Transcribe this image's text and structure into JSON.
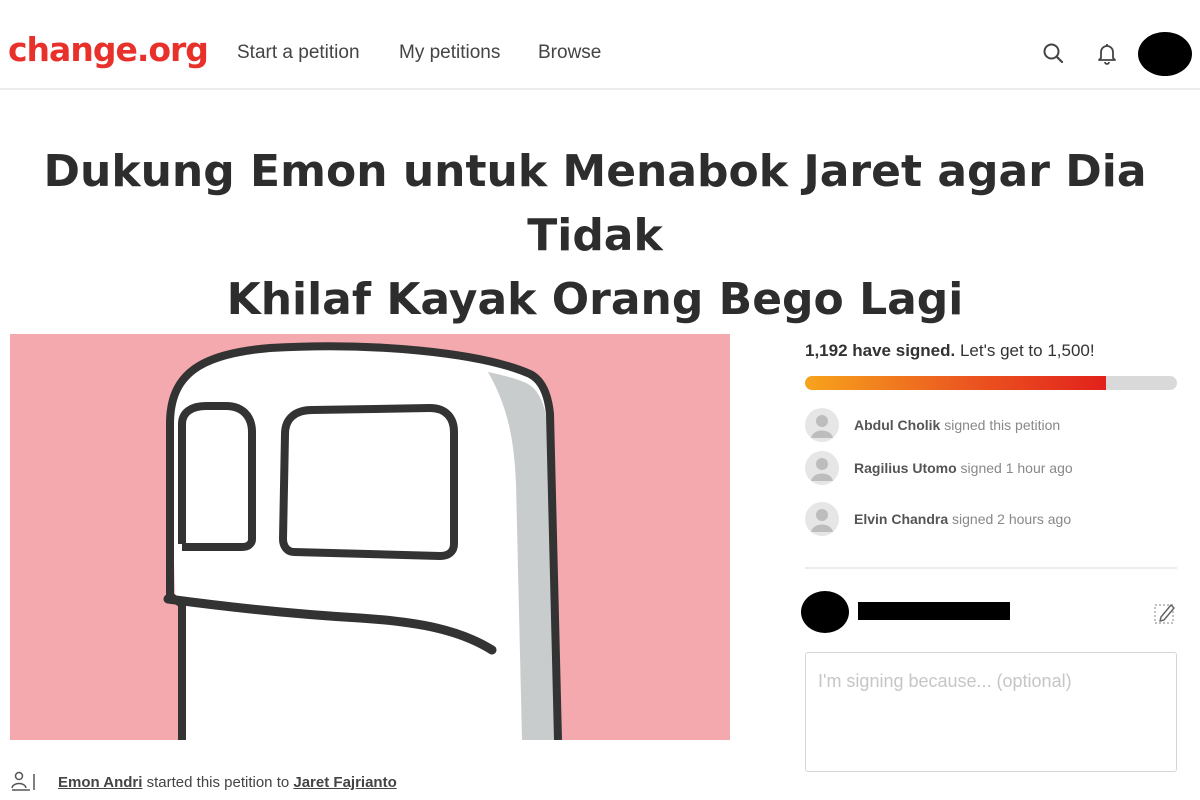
{
  "header": {
    "logo": "change.org",
    "nav": [
      "Start a petition",
      "My petitions",
      "Browse"
    ]
  },
  "petition": {
    "title_line1": "Dukung Emon untuk Menabok Jaret agar Dia Tidak",
    "title_line2": "Khilaf Kayak Orang Bego Lagi",
    "starter_name": "Emon Andri",
    "starter_middle": " started this petition to ",
    "target_name": "Jaret Fajrianto"
  },
  "signatures": {
    "count_text": "1,192 have signed.",
    "goal_text": " Let's get to 1,500!",
    "progress": 0.81,
    "recent": [
      {
        "name": "Abdul Cholik",
        "action": " signed this petition"
      },
      {
        "name": "Ragilius Utomo",
        "action": " signed 1 hour ago"
      },
      {
        "name": "Elvin Chandra",
        "action": " signed 2 hours ago"
      }
    ]
  },
  "sign_form": {
    "reason_placeholder": "I'm signing because... (optional)"
  },
  "colors": {
    "brand": "#e8312a",
    "hero_bg": "#f3a9ae",
    "progress_start": "#f7a41c",
    "progress_end": "#e2211c"
  },
  "icons": [
    "search-icon",
    "bell-icon",
    "user-avatar-icon",
    "edit-icon",
    "person-icon",
    "petition-starter-icon"
  ]
}
